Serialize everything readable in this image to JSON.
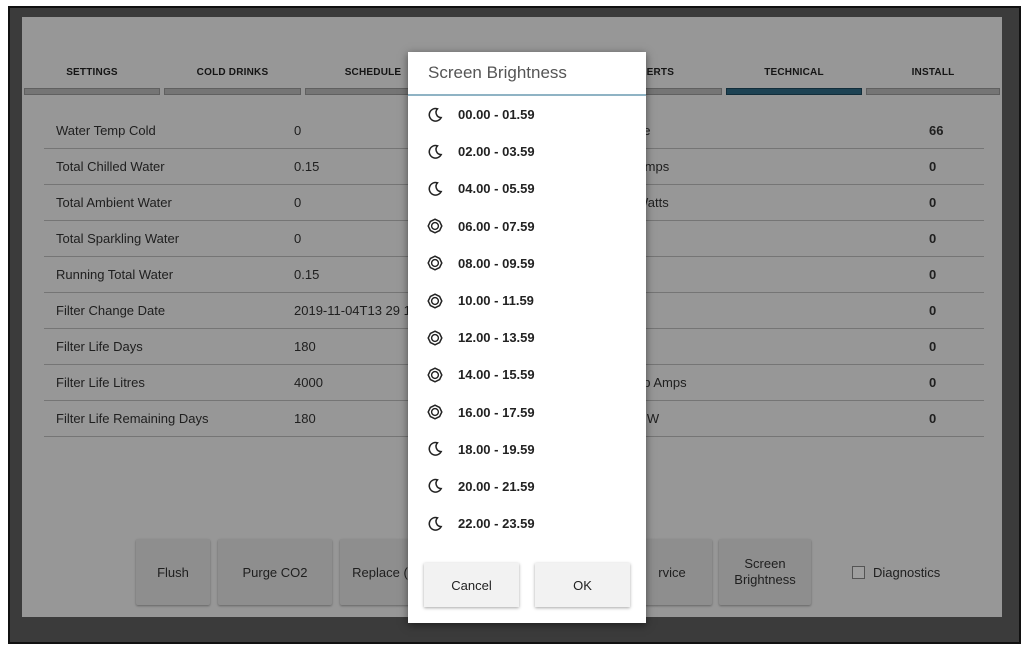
{
  "tabs": [
    {
      "label": "SETTINGS",
      "active": false
    },
    {
      "label": "COLD DRINKS",
      "active": false
    },
    {
      "label": "SCHEDULE",
      "active": false
    },
    {
      "label": "",
      "active": false
    },
    {
      "label": "ALERTS",
      "active": false
    },
    {
      "label": "TECHNICAL",
      "active": true
    },
    {
      "label": "INSTALL",
      "active": false
    }
  ],
  "rows": [
    {
      "name": "Water Temp Cold",
      "value": "0",
      "name2": "ge",
      "value2": "66"
    },
    {
      "name": "Total Chilled Water",
      "value": "0.15",
      "name2": "Amps",
      "value2": "0"
    },
    {
      "name": "Total Ambient Water",
      "value": "0",
      "name2": "Watts",
      "value2": "0"
    },
    {
      "name": "Total Sparkling Water",
      "value": "0",
      "name2": "",
      "value2": "0"
    },
    {
      "name": "Running Total Water",
      "value": "0.15",
      "name2": "",
      "value2": "0"
    },
    {
      "name": "Filter Change Date",
      "value": "2019-11-04T13 29 1",
      "name2": "",
      "value2": "0"
    },
    {
      "name": "Filter Life Days",
      "value": "180",
      "name2": "",
      "value2": "0"
    },
    {
      "name": "Filter Life Litres",
      "value": "4000",
      "name2": "np Amps",
      "value2": "0"
    },
    {
      "name": "Filter Life Remaining Days",
      "value": "180",
      "name2": "n W",
      "value2": "0"
    }
  ],
  "buttons": {
    "flush": "Flush",
    "purge": "Purge CO2",
    "replace": "Replace (",
    "service_line1": "rvice",
    "service_line2": "",
    "screen_brightness": "Screen Brightness"
  },
  "diagnostics": {
    "label": "Diagnostics",
    "checked": false
  },
  "dialog": {
    "title": "Screen Brightness",
    "options": [
      {
        "label": "00.00 - 01.59",
        "icon": "moon-icon"
      },
      {
        "label": "02.00 - 03.59",
        "icon": "moon-icon"
      },
      {
        "label": "04.00 - 05.59",
        "icon": "moon-icon"
      },
      {
        "label": "06.00 - 07.59",
        "icon": "sun-icon"
      },
      {
        "label": "08.00 - 09.59",
        "icon": "sun-icon"
      },
      {
        "label": "10.00 - 11.59",
        "icon": "sun-icon"
      },
      {
        "label": "12.00 - 13.59",
        "icon": "sun-icon"
      },
      {
        "label": "14.00 - 15.59",
        "icon": "sun-icon"
      },
      {
        "label": "16.00 - 17.59",
        "icon": "sun-icon"
      },
      {
        "label": "18.00 - 19.59",
        "icon": "moon-icon"
      },
      {
        "label": "20.00 - 21.59",
        "icon": "moon-icon"
      },
      {
        "label": "22.00 - 23.59",
        "icon": "moon-icon"
      }
    ],
    "cancel": "Cancel",
    "ok": "OK"
  },
  "colors": {
    "active_tab": "#2f6b86",
    "dialog_divider": "#8fb3c4"
  }
}
